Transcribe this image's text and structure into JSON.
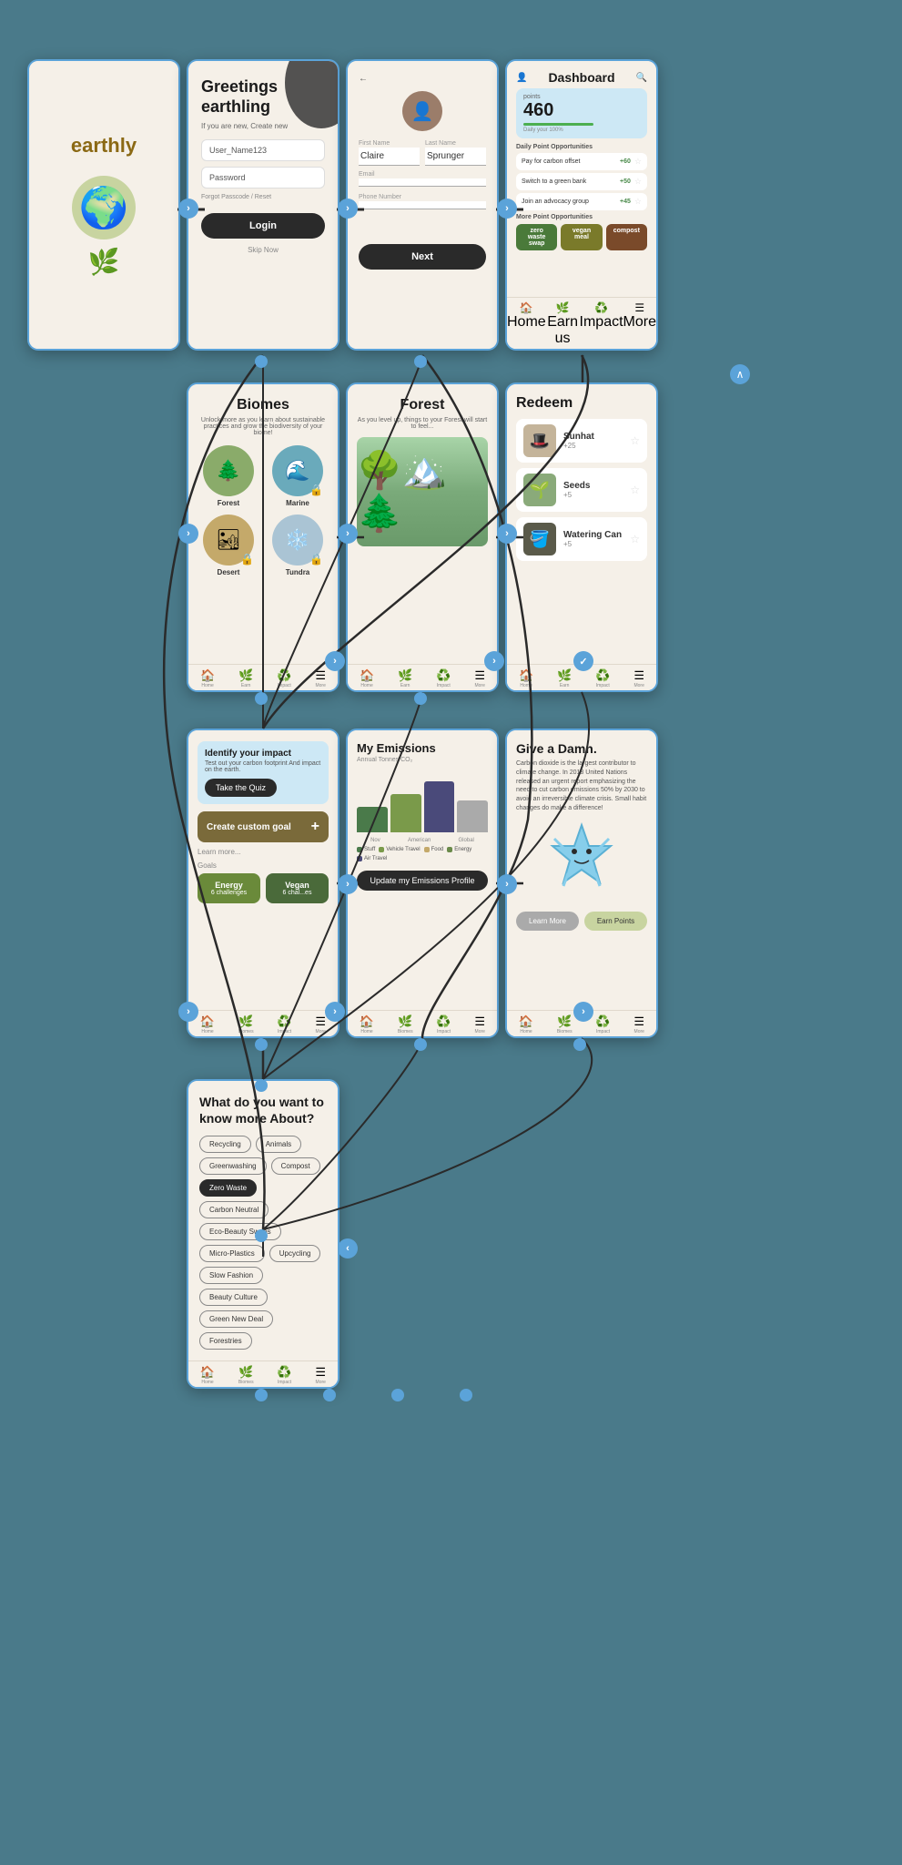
{
  "app": {
    "name": "earthly",
    "brand_color": "#8b6914",
    "accent_color": "#5ba3d9"
  },
  "screens": {
    "splash": {
      "title": "earthly",
      "emoji": "🌍"
    },
    "login": {
      "title": "Greetings\nearthling",
      "subtitle": "If you are new, Create new",
      "username_placeholder": "User_Name123",
      "password_placeholder": "Password",
      "forgot_text": "Forgot Passcode / Reset",
      "login_btn": "Login",
      "skip_btn": "Skip Now"
    },
    "profile": {
      "back": "←",
      "first_name_label": "First Name",
      "first_name_value": "Claire",
      "last_name_label": "Last Name",
      "last_name_value": "Sprunger",
      "email_label": "Email",
      "phone_label": "Phone Number",
      "next_btn": "Next"
    },
    "dashboard": {
      "title": "Dashboard",
      "points_label": "points",
      "points_value": "460",
      "daily_label": "Daily Point Opportunities",
      "opportunities": [
        {
          "text": "Pay for carbon offset",
          "pts": "+60"
        },
        {
          "text": "Switch to a green bank",
          "pts": "+50"
        },
        {
          "text": "Join an advocacy group",
          "pts": "+45"
        }
      ],
      "more_label": "More Point Opportunities",
      "chips": [
        "zero waste swap",
        "vegan meal",
        "compost"
      ],
      "nav_items": [
        "Home",
        "Earn us",
        "Impact",
        "More"
      ]
    },
    "biomes": {
      "title": "Biomes",
      "subtitle": "Unlock more as you learn about sustainable practices and grow the biodiversity of your biome!",
      "items": [
        {
          "label": "Forest",
          "emoji": "🌲",
          "locked": false
        },
        {
          "label": "Marine",
          "emoji": "🌊",
          "locked": true
        },
        {
          "label": "Desert",
          "emoji": "🏜",
          "locked": true
        },
        {
          "label": "Tundra",
          "emoji": "❄️",
          "locked": true
        }
      ]
    },
    "forest": {
      "title": "Forest",
      "subtitle": "As you level up, things to your Forest will start to feel..."
    },
    "redeem": {
      "title": "Redeem",
      "items": [
        {
          "name": "Sunhat",
          "pts": "+25",
          "emoji": "🎩"
        },
        {
          "name": "Seeds",
          "pts": "+5",
          "emoji": "🌱"
        },
        {
          "name": "Watering Can",
          "pts": "+5",
          "emoji": "🪣"
        }
      ]
    },
    "goals": {
      "quiz_title": "Identify your impact",
      "quiz_sub": "Test out your carbon footprint And impact on the earth.",
      "quiz_btn": "Take the Quiz",
      "custom_goal": "Create custom goal",
      "learn_more": "Learn more...",
      "goal_label": "Goals",
      "chips": [
        {
          "label": "Energy",
          "sub": "6 challenges"
        },
        {
          "label": "Vegan",
          "sub": "6 chal...es"
        }
      ]
    },
    "emissions": {
      "title": "My Emissions",
      "subtitle": "Annual Tonnes CO₂",
      "bars": [
        {
          "label": "Nov",
          "color": "#4a7a4a"
        },
        {
          "label": "American",
          "color": "#7a9a4a"
        },
        {
          "label": "Global",
          "color": "#8a8a8a"
        }
      ],
      "legend": [
        "Stuff",
        "Vehicle Travel",
        "Food",
        "Energy",
        "Air Travel"
      ],
      "update_btn": "Update my Emissions Profile"
    },
    "give_damn": {
      "title": "Give a Damn.",
      "subtitle": "Carbon dioxide is the largest contributor to climate change. In 2018 United Nations released an urgent report emphasizing the need to cut carbon emissions 50% by 2030 to avoid an irreversible climate crisis. Small habit changes do make a difference!",
      "character": "⭐",
      "learn_btn": "Learn More",
      "earn_btn": "Earn Points"
    },
    "topics": {
      "title": "What do you want to know more About?",
      "tags": [
        {
          "label": "Recycling",
          "selected": false
        },
        {
          "label": "Animals",
          "selected": false
        },
        {
          "label": "Greenwashing",
          "selected": false
        },
        {
          "label": "Compost",
          "selected": false
        },
        {
          "label": "Zero Waste",
          "selected": true
        },
        {
          "label": "Carbon Neutral",
          "selected": false
        },
        {
          "label": "Eco-Beauty Swaps",
          "selected": false
        },
        {
          "label": "Micro-Plastics",
          "selected": false
        },
        {
          "label": "Upcycling",
          "selected": false
        },
        {
          "label": "Slow Fashion",
          "selected": false
        },
        {
          "label": "Beauty Culture",
          "selected": false
        },
        {
          "label": "Green New Deal",
          "selected": false
        },
        {
          "label": "Forestries",
          "selected": false
        }
      ]
    }
  }
}
